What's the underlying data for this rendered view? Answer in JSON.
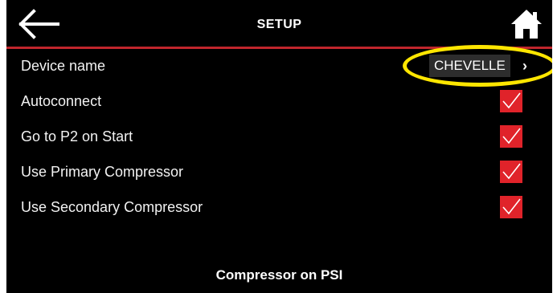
{
  "header": {
    "title": "SETUP",
    "back_icon": "arrow-left-icon",
    "home_icon": "home-icon"
  },
  "settings": {
    "device_name_label": "Device name",
    "device_name_value": "CHEVELLE",
    "device_name_chevron": "›",
    "items": [
      {
        "label": "Autoconnect",
        "checked": true
      },
      {
        "label": "Go to P2 on Start",
        "checked": true
      },
      {
        "label": "Use Primary Compressor",
        "checked": true
      },
      {
        "label": "Use Secondary Compressor",
        "checked": true
      }
    ]
  },
  "section": {
    "heading": "Compressor on PSI"
  },
  "colors": {
    "accent": "#e0232a",
    "background": "#000000",
    "highlight": "#ffe600"
  }
}
